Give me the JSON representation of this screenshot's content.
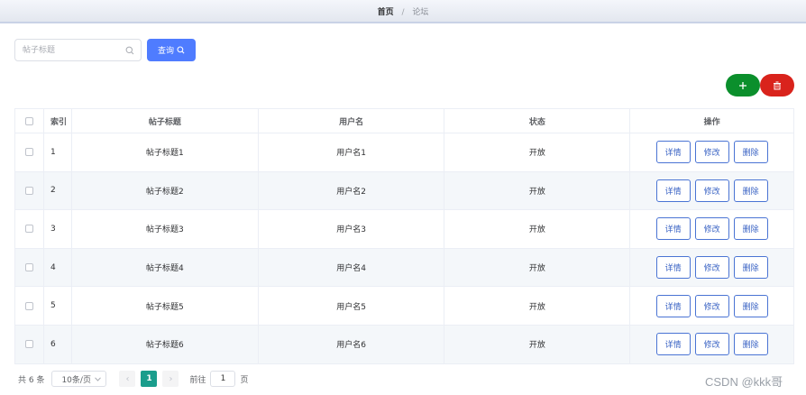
{
  "breadcrumb": {
    "home": "首页",
    "separator": "/",
    "current": "论坛"
  },
  "search": {
    "placeholder": "帖子标题",
    "value": "",
    "button_label": "查询"
  },
  "toolbar": {
    "add_icon": "plus-icon",
    "delete_icon": "trash-icon",
    "add_color": "#0b8f2c",
    "delete_color": "#d9231c"
  },
  "table": {
    "columns": [
      "索引",
      "帖子标题",
      "用户名",
      "状态",
      "操作"
    ],
    "actions": [
      "详情",
      "修改",
      "删除"
    ],
    "rows": [
      {
        "index": "1",
        "title": "帖子标题1",
        "username": "用户名1",
        "status": "开放"
      },
      {
        "index": "2",
        "title": "帖子标题2",
        "username": "用户名2",
        "status": "开放"
      },
      {
        "index": "3",
        "title": "帖子标题3",
        "username": "用户名3",
        "status": "开放"
      },
      {
        "index": "4",
        "title": "帖子标题4",
        "username": "用户名4",
        "status": "开放"
      },
      {
        "index": "5",
        "title": "帖子标题5",
        "username": "用户名5",
        "status": "开放"
      },
      {
        "index": "6",
        "title": "帖子标题6",
        "username": "用户名6",
        "status": "开放"
      }
    ]
  },
  "pagination": {
    "total": "共 6 条",
    "page_size": "10条/页",
    "prev": "‹",
    "current_page": "1",
    "next": "›",
    "goto_label": "前往",
    "goto_value": "1",
    "goto_suffix": "页"
  },
  "watermark": "CSDN @kkk哥",
  "colors": {
    "primary": "#4f7cff",
    "page_active": "#1a9d8c",
    "action_border": "#4a74d4"
  }
}
